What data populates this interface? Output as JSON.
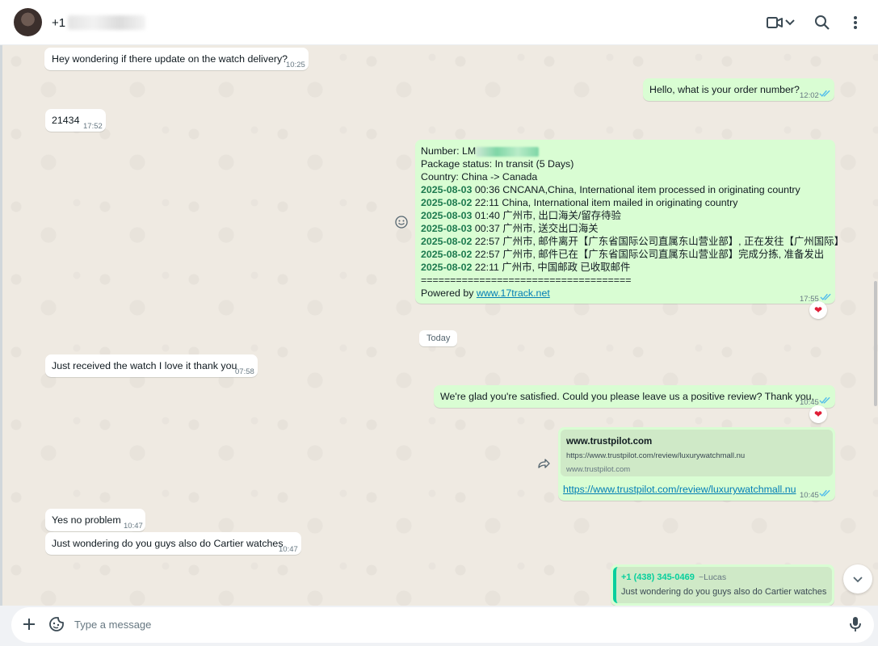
{
  "header": {
    "contact_name": "+1",
    "icons": [
      "video-call-icon",
      "chevron-down-icon",
      "search-icon",
      "menu-icon"
    ]
  },
  "messages": [
    {
      "dir": "in",
      "text": "Hey wondering if there update on the watch delivery?",
      "time": "10:25"
    },
    {
      "dir": "out",
      "text": "Hello, what is your order number?",
      "time": "12:02"
    },
    {
      "dir": "in",
      "text": "21434",
      "time": "17:52"
    },
    {
      "dir": "out",
      "time": "17:55",
      "tracking": {
        "number_label": "Number: LM",
        "status": "Package status: In transit (5 Days)",
        "country": "Country: China -> Canada",
        "events": [
          {
            "date": "2025-08-03",
            "text": "00:36 CNCANA,China, International item processed in originating country"
          },
          {
            "date": "2025-08-02",
            "text": "22:11 China, International item mailed in originating country"
          },
          {
            "date": "2025-08-03",
            "text": "01:40 广州市, 出口海关/留存待验"
          },
          {
            "date": "2025-08-03",
            "text": "00:37 广州市, 送交出口海关"
          },
          {
            "date": "2025-08-02",
            "text": "22:57 广州市, 邮件离开【广东省国际公司直属东山营业部】, 正在发往【广州国际】"
          },
          {
            "date": "2025-08-02",
            "text": "22:57 广州市, 邮件已在【广东省国际公司直属东山营业部】完成分拣, 准备发出"
          },
          {
            "date": "2025-08-02",
            "text": "22:11 广州市, 中国邮政 已收取邮件"
          }
        ],
        "divider": "====================================",
        "powered_prefix": "Powered by ",
        "powered_link": "www.17track.net"
      },
      "reaction": "❤"
    },
    {
      "dir": "in",
      "text": "Just received the watch I love it thank you",
      "time": "07:58"
    },
    {
      "dir": "out",
      "text": "We're glad you're satisfied. Could you please leave us a positive review? Thank you.",
      "time": "10:45",
      "reaction": "❤"
    },
    {
      "dir": "out",
      "time": "10:45",
      "preview": {
        "title": "www.trustpilot.com",
        "url": "https://www.trustpilot.com/review/luxurywatchmall.nu",
        "domain": "www.trustpilot.com"
      },
      "link": "https://www.trustpilot.com/review/luxurywatchmall.nu"
    },
    {
      "dir": "in",
      "text": "Yes no problem",
      "time": "10:47"
    },
    {
      "dir": "in",
      "text": "Just wondering do you guys also do Cartier watches",
      "time": "10:47"
    },
    {
      "dir": "out",
      "quote": {
        "sender": "+1 (438) 345-0469",
        "name": "~Lucas",
        "text": "Just wondering do you guys also do Cartier watches"
      }
    }
  ],
  "date_separator": "Today",
  "composer": {
    "placeholder": "Type a message"
  },
  "colors": {
    "outgoing": "#d9fdd3",
    "incoming": "#ffffff",
    "ticks": "#53bdeb",
    "accent": "#1d7a4f",
    "reaction": "#e01e37"
  }
}
